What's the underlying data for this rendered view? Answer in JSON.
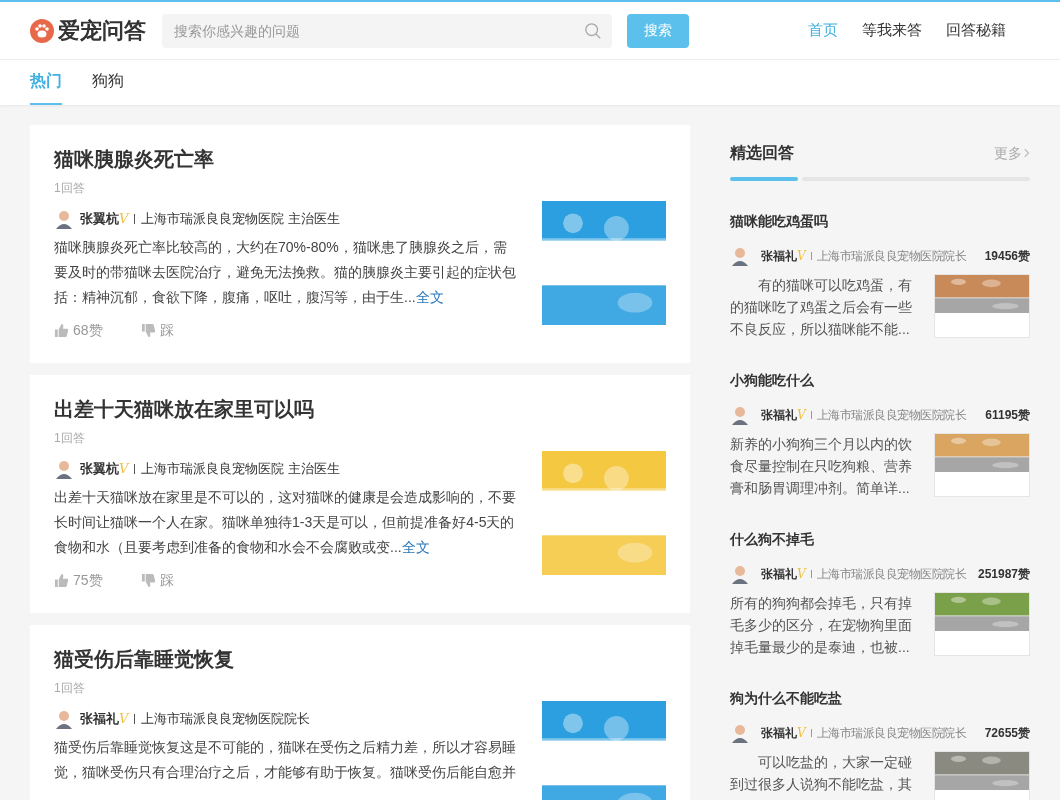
{
  "header": {
    "logo": "爱宠问答",
    "search": {
      "placeholder": "搜索你感兴趣的问题"
    },
    "search_button": "搜索",
    "nav": [
      {
        "label": "首页",
        "selected": true
      },
      {
        "label": "等我来答",
        "selected": false
      },
      {
        "label": "回答秘籍",
        "selected": false
      }
    ]
  },
  "tabs": [
    {
      "label": "热门",
      "selected": true
    },
    {
      "label": "狗狗",
      "selected": false
    }
  ],
  "questions": [
    {
      "title": "猫咪胰腺炎死亡率",
      "answers": "1回答",
      "author": "张翼杭",
      "badge": "V",
      "org": "上海市瑞派良良宠物医院 主治医生",
      "excerpt": "猫咪胰腺炎死亡率比较高的，大约在70%-80%，猫咪患了胰腺炎之后，需要及时的带猫咪去医院治疗，避免无法挽救。猫的胰腺炎主要引起的症状包括：精神沉郁，食欲下降，腹痛，呕吐，腹泻等，由于生...",
      "more": "全文",
      "likes": "68赞",
      "dislike": "踩",
      "thumb": {
        "color": "#2b9fe0"
      }
    },
    {
      "title": "出差十天猫咪放在家里可以吗",
      "answers": "1回答",
      "author": "张翼杭",
      "badge": "V",
      "org": "上海市瑞派良良宠物医院 主治医生",
      "excerpt": "出差十天猫咪放在家里是不可以的，这对猫咪的健康是会造成影响的，不要长时间让猫咪一个人在家。猫咪单独待1-3天是可以，但前提准备好4-5天的食物和水（且要考虑到准备的食物和水会不会腐败或变...",
      "more": "全文",
      "likes": "75赞",
      "dislike": "踩",
      "thumb": {
        "color": "#f5c842"
      }
    },
    {
      "title": "猫受伤后靠睡觉恢复",
      "answers": "1回答",
      "author": "张福礼",
      "badge": "V",
      "org": "上海市瑞派良良宠物医院院长",
      "excerpt": "猫受伤后靠睡觉恢复这是不可能的，猫咪在受伤之后精力差，所以才容易睡觉，猫咪受伤只有合理治疗之后，才能够有助于恢复。猫咪受伤后能自愈并",
      "thumb": {
        "color": "#2b9fe0"
      }
    }
  ],
  "sidebar": {
    "title": "精选回答",
    "more": "更多",
    "items": [
      {
        "title": "猫咪能吃鸡蛋吗",
        "author": "张福礼",
        "badge": "V",
        "org": "上海市瑞派良良宠物医院院长",
        "likes": "19456赞",
        "excerpt": "　　有的猫咪可以吃鸡蛋，有的猫咪吃了鸡蛋之后会有一些不良反应，所以猫咪能不能...",
        "thumb": {
          "color": "#c98a5a"
        }
      },
      {
        "title": "小狗能吃什么",
        "author": "张福礼",
        "badge": "V",
        "org": "上海市瑞派良良宠物医院院长",
        "likes": "61195赞",
        "excerpt": "新养的小狗狗三个月以内的饮食尽量控制在只吃狗粮、营养膏和肠胃调理冲剂。简单详...",
        "thumb": {
          "color": "#d9a560"
        }
      },
      {
        "title": "什么狗不掉毛",
        "author": "张福礼",
        "badge": "V",
        "org": "上海市瑞派良良宠物医院院长",
        "likes": "251987赞",
        "excerpt": "所有的狗狗都会掉毛，只有掉毛多少的区分，在宠物狗里面掉毛量最少的是泰迪，也被...",
        "thumb": {
          "color": "#7aa04a"
        }
      },
      {
        "title": "狗为什么不能吃盐",
        "author": "张福礼",
        "badge": "V",
        "org": "上海市瑞派良良宠物医院院长",
        "likes": "72655赞",
        "excerpt": "　　可以吃盐的，大家一定碰到过很多人说狗不能吃盐，其",
        "thumb": {
          "color": "#8a8a80"
        }
      }
    ]
  }
}
